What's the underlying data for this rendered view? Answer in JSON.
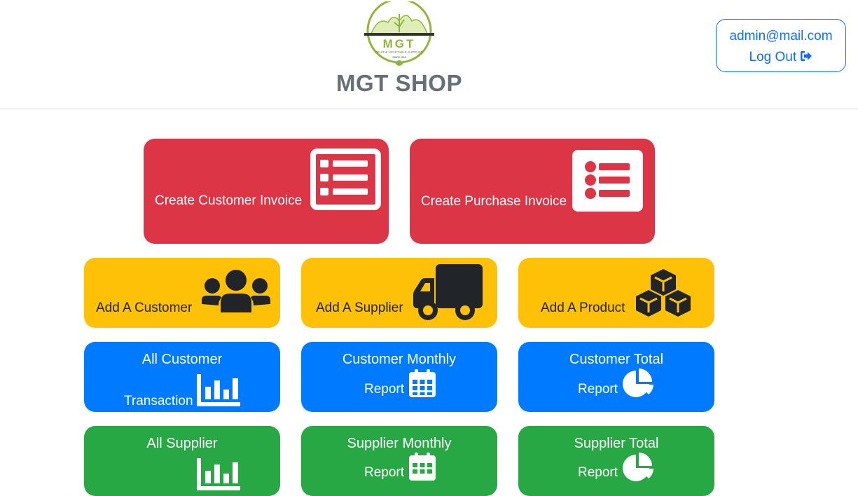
{
  "header": {
    "logo": {
      "name": "MGT",
      "tagline": "FRUIT & VEGETABLE SUPPLIER",
      "since": "SINCE 2015"
    },
    "shop_title": "MGT SHOP",
    "account": {
      "email": "admin@mail.com",
      "logout_label": "Log Out",
      "logout_icon": "sign-out-icon"
    }
  },
  "colors": {
    "danger": "#dc3545",
    "warning": "#ffc107",
    "primary": "#007bff",
    "success": "#28a745"
  },
  "tiles": {
    "create_customer_invoice": {
      "label": "Create Customer Invoice",
      "icon": "list-alt-icon"
    },
    "create_purchase_invoice": {
      "label": "Create Purchase Invoice",
      "icon": "list-icon"
    },
    "add_customer": {
      "label": "Add A Customer",
      "icon": "users-icon"
    },
    "add_supplier": {
      "label": "Add A Supplier",
      "icon": "truck-icon"
    },
    "add_product": {
      "label": "Add A Product",
      "icon": "cubes-icon"
    },
    "all_customer_transaction": {
      "line1": "All Customer",
      "line2": "Transaction",
      "icon": "bar-chart-icon"
    },
    "customer_monthly_report": {
      "line1": "Customer Monthly",
      "line2": "Report",
      "icon": "calendar-icon"
    },
    "customer_total_report": {
      "line1": "Customer Total",
      "line2": "Report",
      "icon": "pie-chart-icon"
    },
    "all_supplier_transaction": {
      "line1": "All Supplier",
      "icon": "bar-chart-icon"
    },
    "supplier_monthly_report": {
      "line1": "Supplier Monthly",
      "line2": "Report",
      "icon": "calendar-icon"
    },
    "supplier_total_report": {
      "line1": "Supplier Total",
      "line2": "Report",
      "icon": "pie-chart-icon"
    }
  }
}
